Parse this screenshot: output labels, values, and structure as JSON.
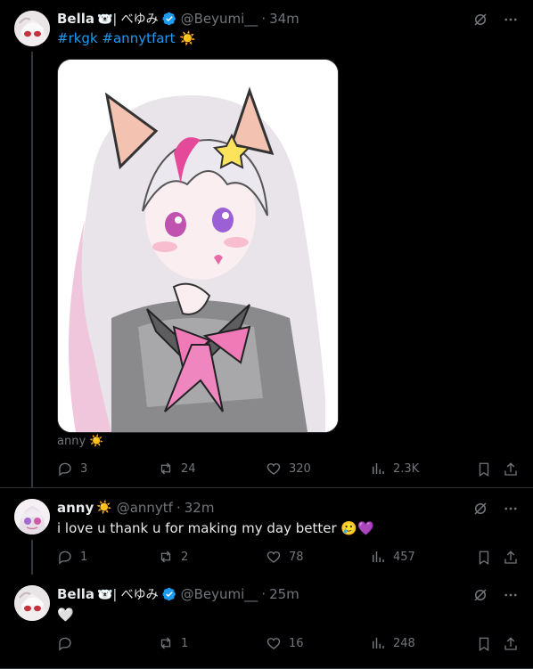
{
  "post1": {
    "name": "Bella",
    "name_suffix": "🐻‍❄️| べゆみ",
    "handle": "@Beyumi__",
    "time": "34m",
    "text_hashtag_1": "#rkgk",
    "text_hashtag_2": "#annytfart",
    "text_emoji": "☀️",
    "image_caption": "anny",
    "image_caption_emoji": "☀️",
    "replies": "3",
    "reposts": "24",
    "likes": "320",
    "views": "2.3K"
  },
  "post2": {
    "name": "anny",
    "name_suffix": "☀️",
    "handle": "@annytf",
    "time": "32m",
    "text": "i love u thank u for making my day better 🥲💜",
    "replies": "1",
    "reposts": "2",
    "likes": "78",
    "views": "457"
  },
  "post3": {
    "name": "Bella",
    "name_suffix": "🐻‍❄️| べゆみ",
    "handle": "@Beyumi__",
    "time": "25m",
    "text": "🤍",
    "replies": "",
    "reposts": "1",
    "likes": "16",
    "views": "248"
  },
  "colors": {
    "accent": "#1d9bf0",
    "muted": "#71767b",
    "text": "#e7e9ea",
    "background": "#000000"
  }
}
